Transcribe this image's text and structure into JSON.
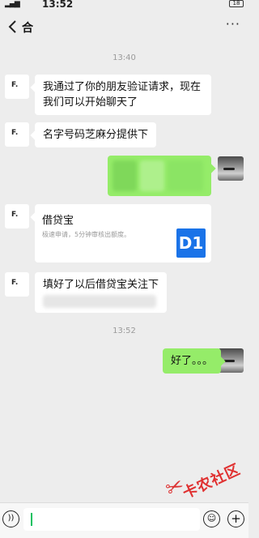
{
  "status": {
    "time": "13:52",
    "battery": "18"
  },
  "header": {
    "title": "合",
    "more_label": "···"
  },
  "avatars": {
    "contact_initial": "F."
  },
  "timestamps": {
    "first": "13:40",
    "second": "13:52"
  },
  "messages": {
    "m1_line1": "我通过了你的朋友验证请求，现在",
    "m1_line2": "我们可以开始聊天了",
    "m2": "名字号码芝麻分提供下",
    "m5_visible": "填好了以后借贷宝关注下",
    "m6": "好了。。。"
  },
  "card": {
    "title": "借贷宝",
    "description": "极速申请，5分钟审核出额度。",
    "logo_text": "D1"
  },
  "watermark": {
    "text": "卡农社区"
  },
  "colors": {
    "bubble_self": "#95ec69",
    "bubble_other": "#ffffff",
    "background": "#ededed",
    "cursor": "#07c160"
  }
}
